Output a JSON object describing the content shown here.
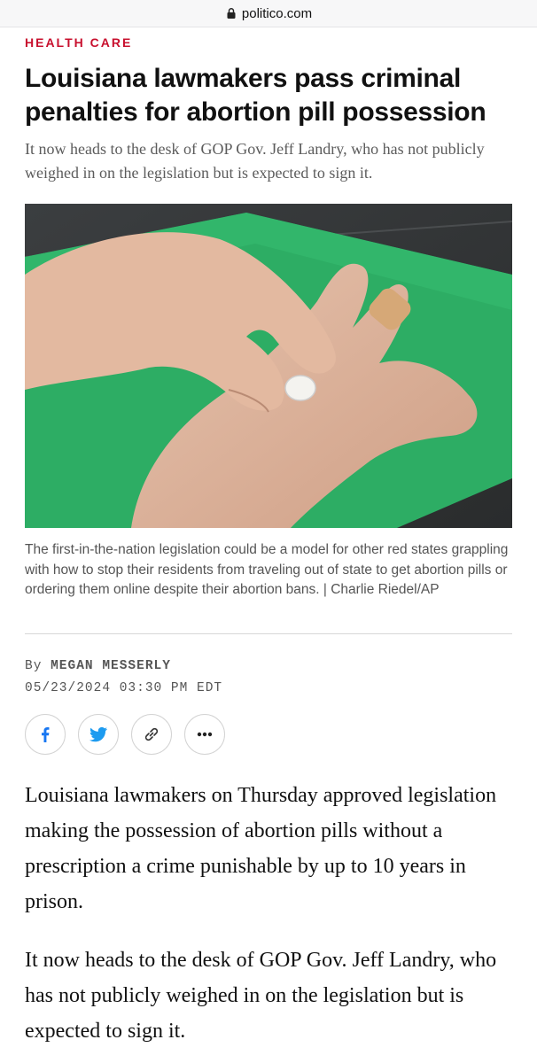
{
  "browser": {
    "url": "politico.com"
  },
  "article": {
    "section": "HEALTH CARE",
    "headline": "Louisiana lawmakers pass criminal penalties for abortion pill possession",
    "dek": "It now heads to the desk of GOP Gov. Jeff Landry, who has not publicly weighed in on the legislation but is expected to sign it.",
    "caption": "The first-in-the-nation legislation could be a model for other red states grappling with how to stop their residents from traveling out of state to get abortion pills or ordering them online despite their abortion bans. | Charlie Riedel/AP",
    "byline_prefix": "By",
    "author": "MEGAN MESSERLY",
    "timestamp": "05/23/2024 03:30 PM EDT",
    "paragraphs": [
      "Louisiana lawmakers on Thursday approved legislation making the possession of abortion pills without a prescription a crime punishable by up to 10 years in prison.",
      "It now heads to the desk of GOP Gov. Jeff Landry, who has not publicly weighed in on the legislation but is expected to sign it."
    ]
  },
  "share": {
    "buttons": [
      {
        "icon": "facebook-icon",
        "color": "#1877f2"
      },
      {
        "icon": "twitter-icon",
        "color": "#1d9bf0"
      },
      {
        "icon": "link-icon",
        "color": "#333333"
      },
      {
        "icon": "more-icon",
        "color": "#333333"
      }
    ]
  },
  "colors": {
    "section": "#c8102e",
    "text": "#111111",
    "muted": "#555555"
  }
}
